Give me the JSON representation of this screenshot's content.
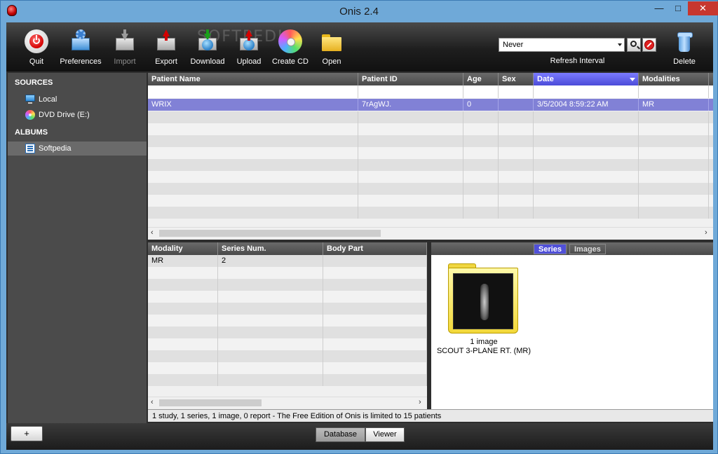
{
  "window": {
    "title": "Onis 2.4"
  },
  "toolbar": {
    "quit": "Quit",
    "preferences": "Preferences",
    "import": "Import",
    "export": "Export",
    "download": "Download",
    "upload": "Upload",
    "create_cd": "Create CD",
    "open": "Open",
    "delete": "Delete",
    "refresh_value": "Never",
    "refresh_label": "Refresh Interval",
    "watermark": "SOFTPEDIA"
  },
  "sidebar": {
    "sources_header": "SOURCES",
    "sources": [
      {
        "label": "Local",
        "icon": "computer-icon"
      },
      {
        "label": "DVD Drive (E:)",
        "icon": "dvd-icon"
      }
    ],
    "albums_header": "ALBUMS",
    "albums": [
      {
        "label": "Softpedia",
        "icon": "album-icon",
        "selected": true
      }
    ]
  },
  "patients": {
    "columns": [
      "Patient Name",
      "Patient ID",
      "Age",
      "Sex",
      "Date",
      "Modalities"
    ],
    "sorted_column": "Date",
    "rows": [
      {
        "name": "WRIX",
        "id": "7rAgWJ.",
        "age": "0",
        "sex": "",
        "date": "3/5/2004 8:59:22 AM",
        "modalities": "MR"
      }
    ]
  },
  "series": {
    "columns": [
      "Modality",
      "Series Num.",
      "Body Part"
    ],
    "rows": [
      {
        "modality": "MR",
        "num": "2",
        "body_part": ""
      }
    ]
  },
  "series_panel": {
    "tabs": [
      "Series",
      "Images"
    ],
    "active_tab": "Series",
    "item": {
      "count": "1 image",
      "description": "SCOUT 3-PLANE RT. (MR)"
    }
  },
  "status": "1 study, 1 series, 1 image, 0 report - The Free Edition of Onis is limited to 15 patients",
  "bottom": {
    "plus": "+",
    "database": "Database",
    "viewer": "Viewer"
  },
  "colors": {
    "selection": "#8181d6",
    "sorted_header": "#5a5ae0",
    "title_bar": "#6fa9d8"
  }
}
